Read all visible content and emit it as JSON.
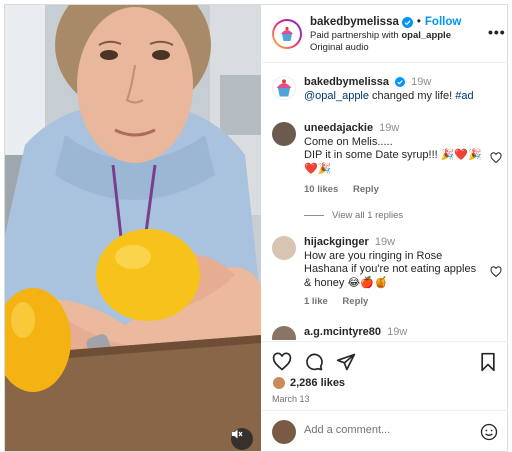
{
  "header": {
    "username": "bakedbymelissa",
    "follow_label": "Follow",
    "partnership_prefix": "Paid partnership with ",
    "partner": "opal_apple",
    "audio": "Original audio"
  },
  "caption": {
    "username": "bakedbymelissa",
    "time": "19w",
    "mention": "@opal_apple",
    "text": " changed my life! ",
    "hashtag": "#ad"
  },
  "comments": [
    {
      "username": "uneedajackie",
      "time": "19w",
      "text": "Come on Melis.....\nDIP it in some Date syrup!!! 🎉❤️🎉❤️🎉",
      "likes": "10 likes",
      "reply_label": "Reply",
      "view_replies": "View all 1 replies"
    },
    {
      "username": "hijackginger",
      "time": "19w",
      "text": "How are you ringing in Rose Hashana if you're not eating apples & honey 😂🍎🍯",
      "likes": "1 like",
      "reply_label": "Reply"
    },
    {
      "username": "a.g.mcintyre80",
      "time": "19w"
    }
  ],
  "actions": {
    "likes": "2,286 likes",
    "date": "March 13"
  },
  "add_comment": {
    "placeholder": "Add a comment..."
  },
  "colors": {
    "link": "#0095f6",
    "verified": "#0095f6",
    "apple": "#f7c21a"
  },
  "icons": [
    "more-icon",
    "heart-icon",
    "comment-icon",
    "share-icon",
    "bookmark-icon",
    "emoji-icon",
    "mute-icon",
    "verified-icon"
  ]
}
